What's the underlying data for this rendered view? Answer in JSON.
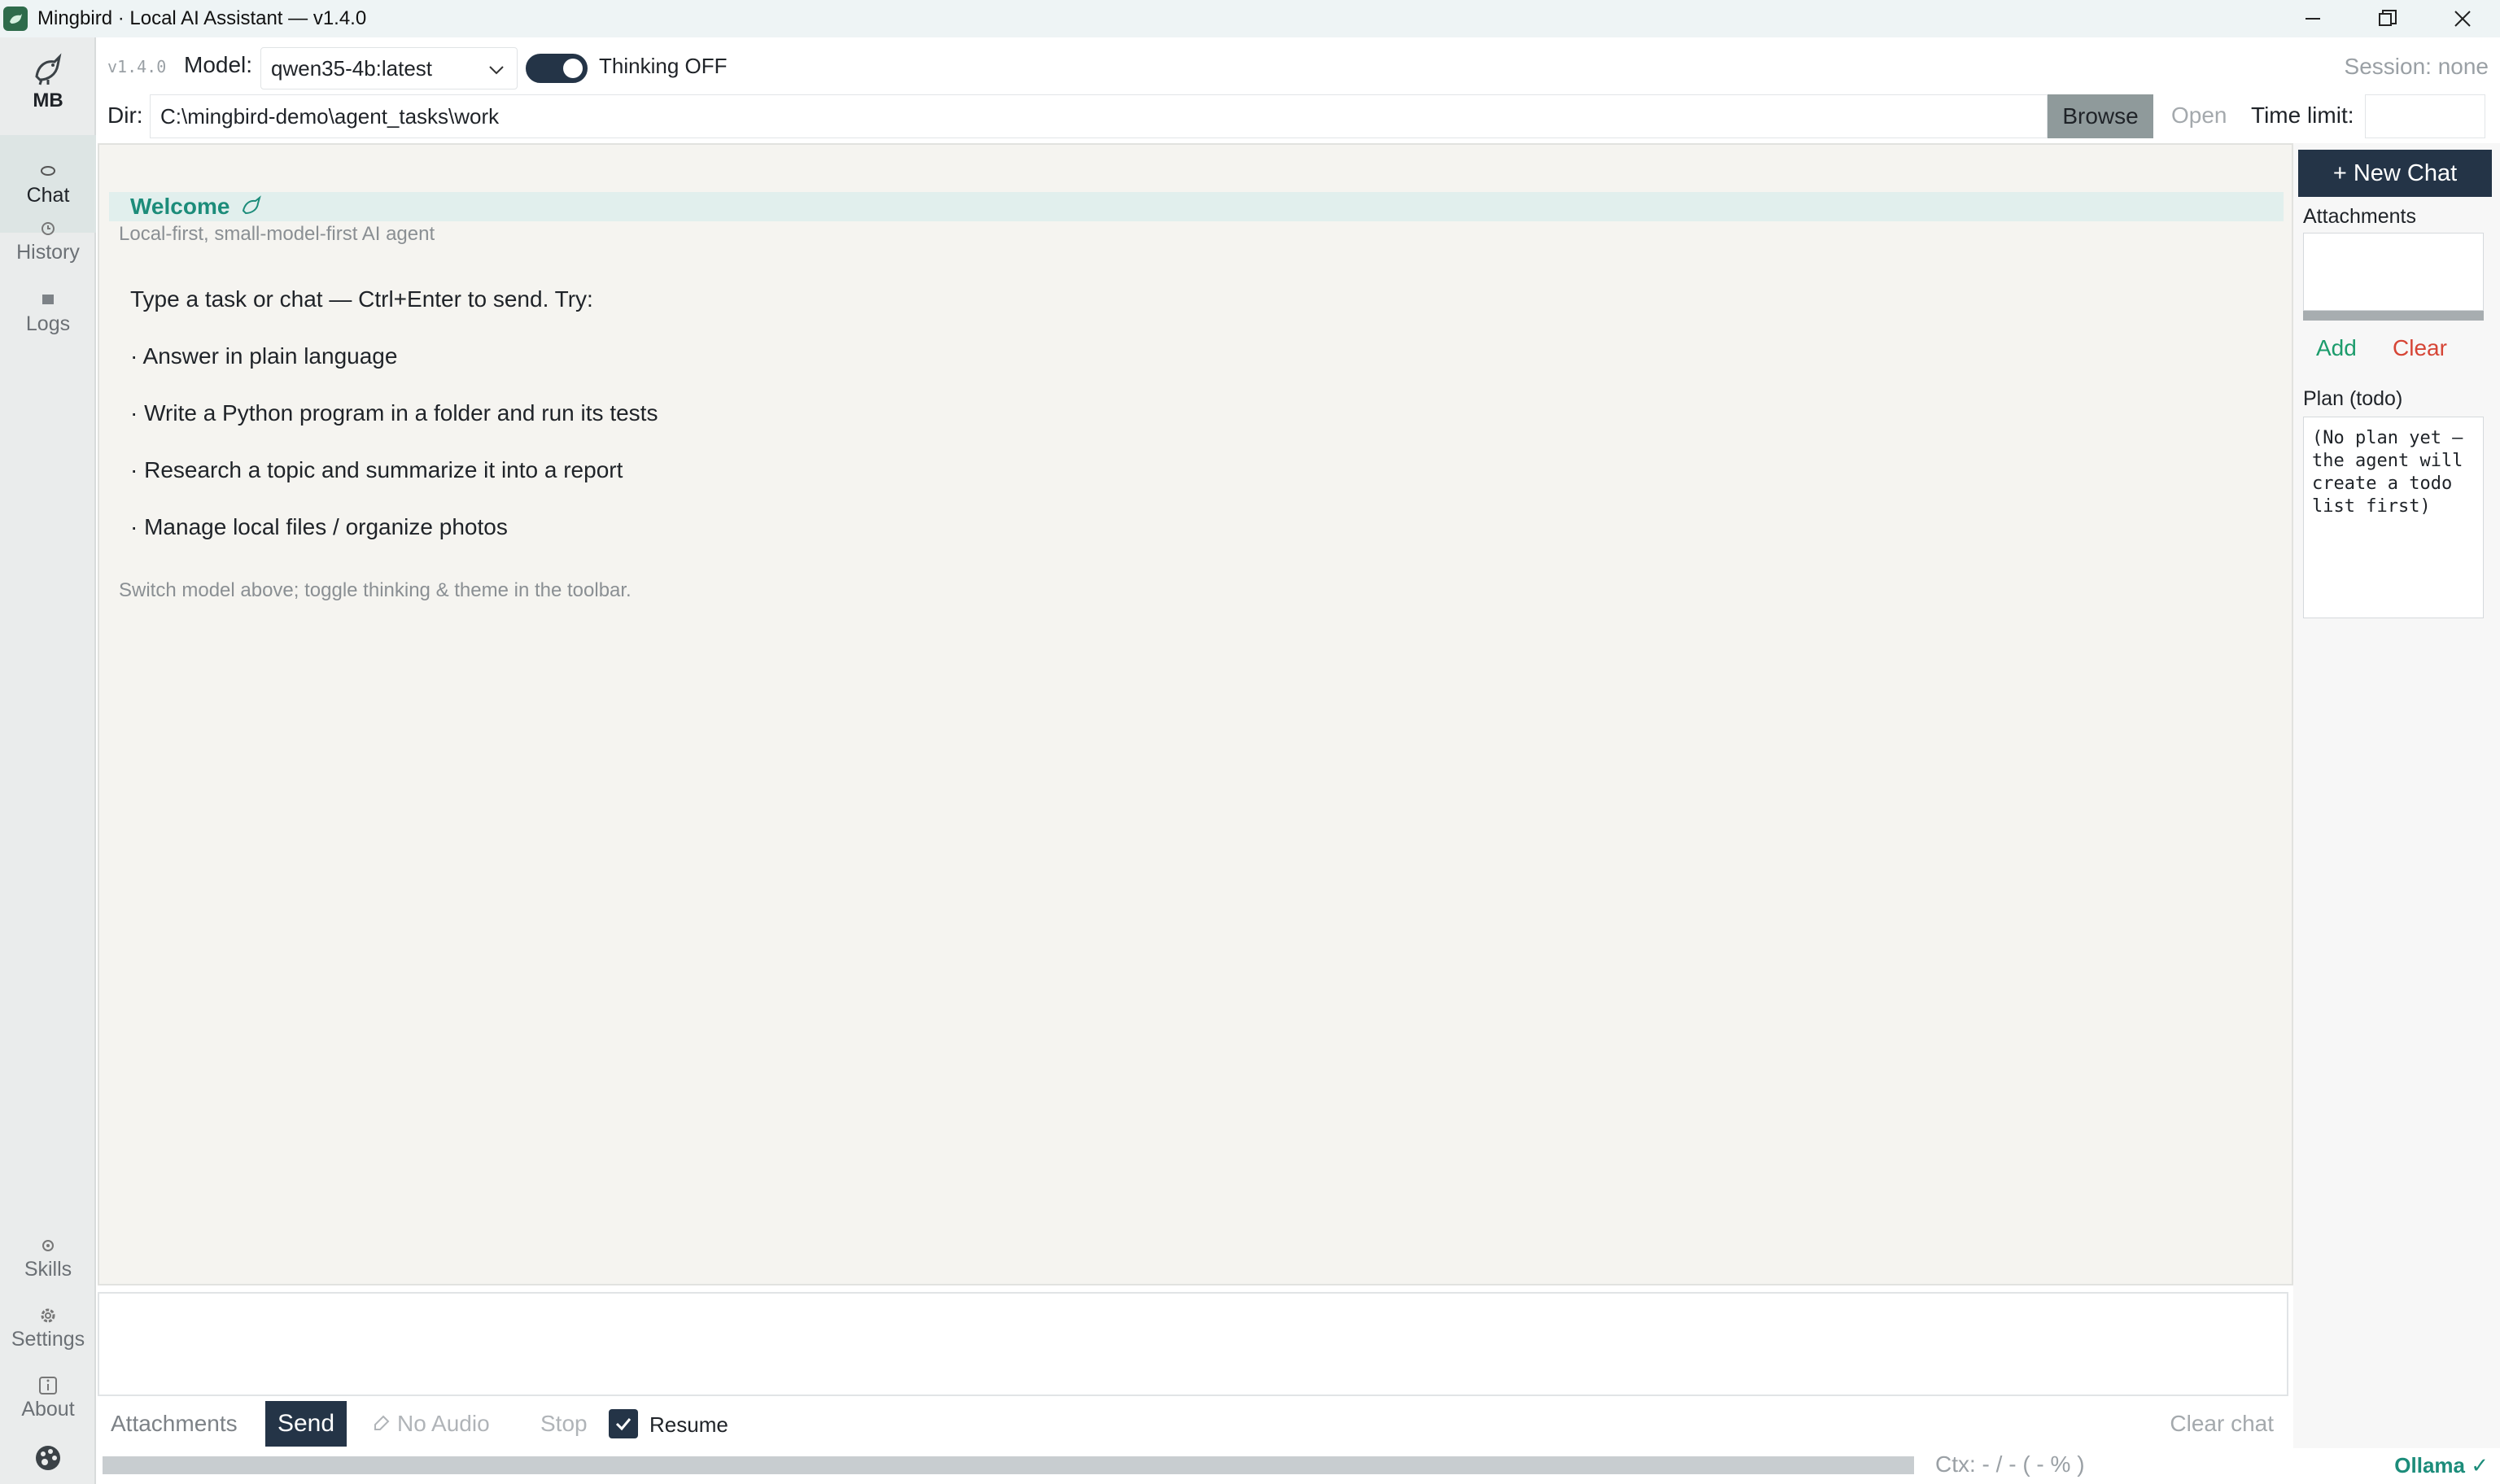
{
  "window": {
    "title": "Mingbird · Local AI Assistant — v1.4.0",
    "app_icon": "bird-icon",
    "controls": [
      "minimize-icon",
      "restore-icon",
      "close-icon"
    ]
  },
  "sidebar": {
    "brand": "MB",
    "items": [
      {
        "label": "Chat",
        "icon": "chat-bubble-icon",
        "active": true
      },
      {
        "label": "History",
        "icon": "clock-icon"
      },
      {
        "label": "Logs",
        "icon": "log-icon"
      }
    ],
    "bottom_items": [
      {
        "label": "Skills",
        "icon": "skills-icon"
      },
      {
        "label": "Settings",
        "icon": "gear-icon"
      },
      {
        "label": "About",
        "icon": "info-icon"
      }
    ],
    "theme_icon": "palette-icon"
  },
  "toolbar": {
    "version": "v1.4.0",
    "model_label": "Model:",
    "model_value": "qwen35-4b:latest",
    "thinking_label": "Thinking OFF",
    "session": "Session: none",
    "dir_label": "Dir:",
    "dir_value": "C:\\mingbird-demo\\agent_tasks\\work",
    "browse": "Browse",
    "open": "Open",
    "time_limit": "Time limit:"
  },
  "chat": {
    "welcome_title": "Welcome",
    "welcome_sub": "Local-first, small-model-first AI agent",
    "lines": [
      "Type a task or chat — Ctrl+Enter to send. Try:",
      "· Answer in plain language",
      "· Write a Python program in a folder and run its tests",
      "· Research a topic and summarize it into a report",
      "· Manage local files / organize photos"
    ],
    "hint": "Switch model above; toggle thinking & theme in the toolbar."
  },
  "bottom": {
    "attachments": "Attachments",
    "send": "Send",
    "no_audio": "No Audio",
    "stop": "Stop",
    "resume": "Resume",
    "resume_checked": true,
    "clear_chat": "Clear chat",
    "ctx": "Ctx: - / - ( - % )",
    "ollama": "Ollama ✓"
  },
  "right": {
    "new_chat": "+ New Chat",
    "attachments_label": "Attachments",
    "add": "Add",
    "clear": "Clear",
    "plan_label": "Plan (todo)",
    "plan_text": "(No plan yet —\nthe agent will\ncreate a todo\nlist first)"
  }
}
